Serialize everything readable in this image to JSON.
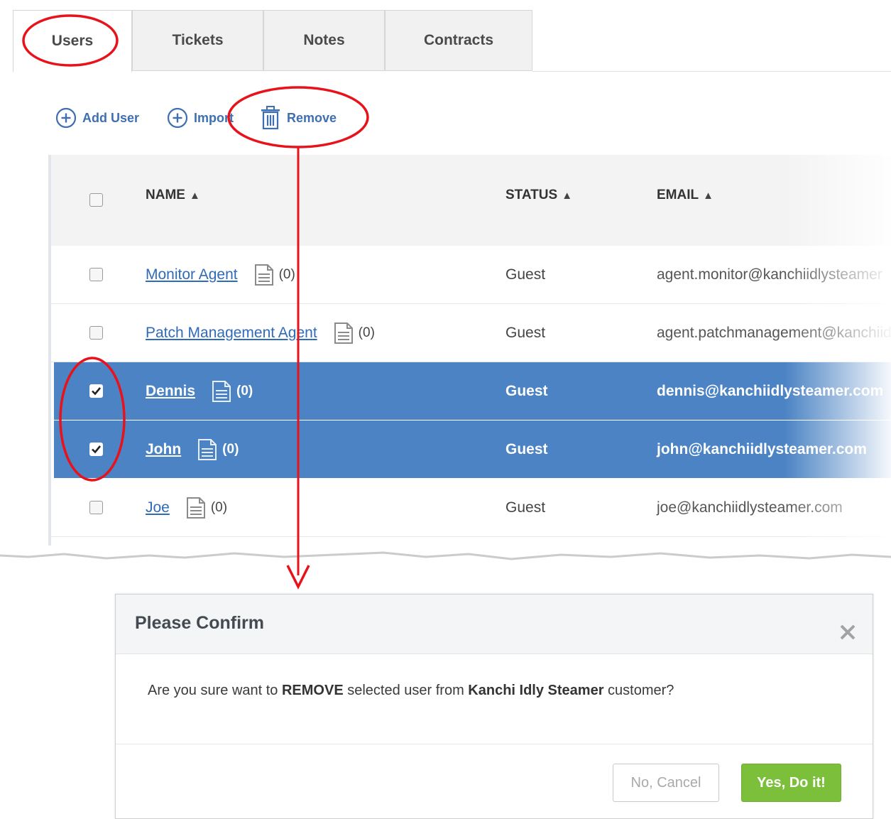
{
  "tabs": [
    {
      "label": "Users",
      "active": true
    },
    {
      "label": "Tickets",
      "active": false
    },
    {
      "label": "Notes",
      "active": false
    },
    {
      "label": "Contracts",
      "active": false
    }
  ],
  "toolbar": {
    "add_user": "Add User",
    "import": "Import",
    "remove": "Remove"
  },
  "table": {
    "headers": {
      "name": "NAME",
      "status": "STATUS",
      "email": "EMAIL",
      "sort_glyph": "⬍"
    },
    "rows": [
      {
        "name": "Monitor Agent",
        "count": "(0)",
        "status": "Guest",
        "email": "agent.monitor@kanchiidlysteamer",
        "checked": false
      },
      {
        "name": "Patch Management Agent",
        "count": "(0)",
        "status": "Guest",
        "email": "agent.patchmanagement@kanchiidlysteamer.com",
        "checked": false
      },
      {
        "name": "Dennis",
        "count": "(0)",
        "status": "Guest",
        "email": "dennis@kanchiidlysteamer.com",
        "checked": true
      },
      {
        "name": "John",
        "count": "(0)",
        "status": "Guest",
        "email": "john@kanchiidlysteamer.com",
        "checked": true
      },
      {
        "name": "Joe",
        "count": "(0)",
        "status": "Guest",
        "email": "joe@kanchiidlysteamer.com",
        "checked": false
      }
    ]
  },
  "dialog": {
    "title": "Please Confirm",
    "message_prefix": "Are you sure want to ",
    "message_action": "REMOVE",
    "message_middle": " selected user from ",
    "message_customer": "Kanchi Idly Steamer",
    "message_suffix": " customer?",
    "cancel_label": "No, Cancel",
    "confirm_label": "Yes, Do it!"
  },
  "colors": {
    "selected_row": "#4b83c4",
    "link": "#2f6bb8",
    "confirm_button": "#7cbf3b",
    "annotation": "#e8121b"
  },
  "icons": {
    "add_user": "plus-circle-icon",
    "import": "plus-circle-icon",
    "remove": "trash-icon",
    "notes": "document-icon",
    "close": "close-icon",
    "sort": "sort-icon",
    "checkmark": "checkmark-icon"
  }
}
